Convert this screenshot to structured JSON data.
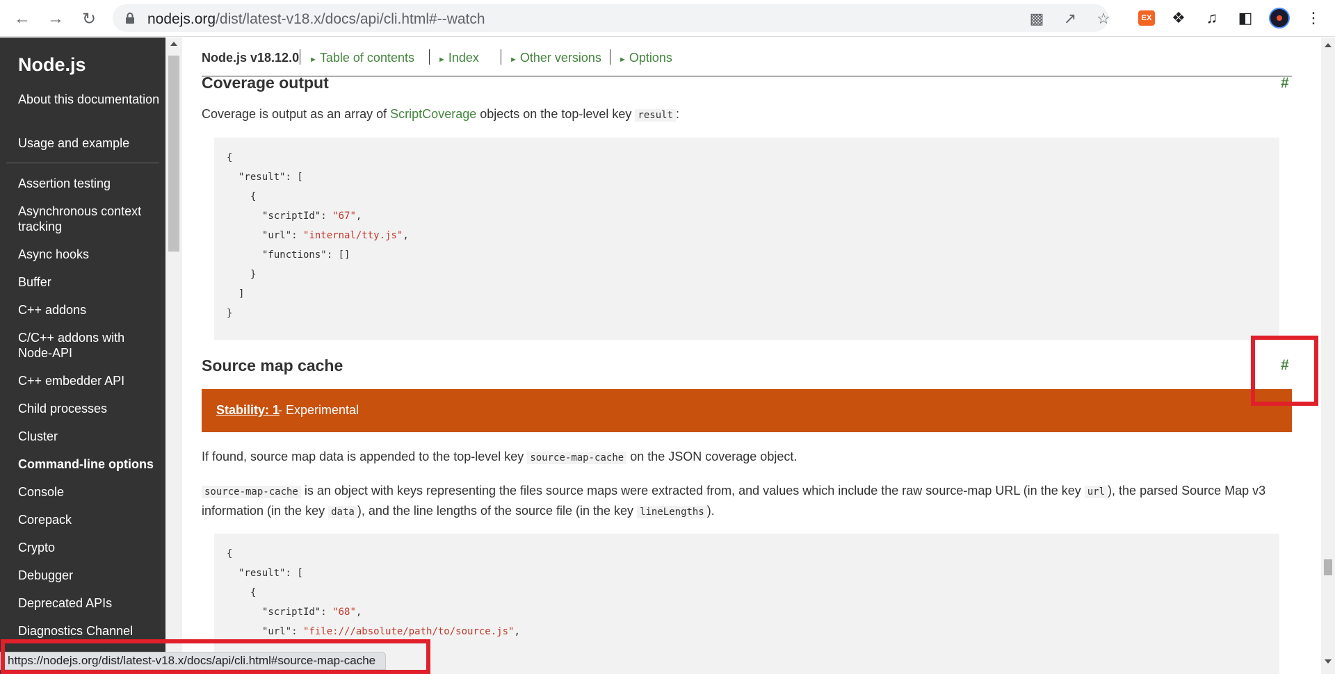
{
  "browser": {
    "url_host": "nodejs.org",
    "url_path": "/dist/latest-v18.x/docs/api/cli.html#--watch",
    "extension_label": "EX"
  },
  "sidebar": {
    "title": "Node.js",
    "top_items": [
      "About this documentation",
      "Usage and example"
    ],
    "items": [
      "Assertion testing",
      "Asynchronous context tracking",
      "Async hooks",
      "Buffer",
      "C++ addons",
      "C/C++ addons with Node-API",
      "C++ embedder API",
      "Child processes",
      "Cluster",
      "Command-line options",
      "Console",
      "Corepack",
      "Crypto",
      "Debugger",
      "Deprecated APIs",
      "Diagnostics Channel"
    ],
    "active_item": "Command-line options"
  },
  "header": {
    "version": "Node.js v18.12.0",
    "links": [
      "Table of contents",
      "Index",
      "Other versions",
      "Options"
    ]
  },
  "content": {
    "coverage_title": "Coverage output",
    "coverage_anchor": "#",
    "coverage_text_1": "Coverage is output as an array of",
    "coverage_link": "ScriptCoverage",
    "coverage_text_2": "objects on the top-level key",
    "coverage_key": "result",
    "coverage_text_3": ":",
    "code1": {
      "l1": "{",
      "l2_key": "\"result\"",
      "l2_rest": ": [",
      "l3": "{",
      "l4_key": "\"scriptId\"",
      "l4_val": "\"67\"",
      "l5_key": "\"url\"",
      "l5_val": "\"internal/tty.js\"",
      "l6_key": "\"functions\"",
      "l6_rest": ": []",
      "l7": "}",
      "l8": "]",
      "l9": "}"
    },
    "smc_title": "Source map cache",
    "smc_anchor": "#",
    "stability_label": "Stability: 1",
    "stability_text": "- Experimental",
    "smc_p1_a": "If found, source map data is appended to the top-level key",
    "smc_p1_code": "source-map-cache",
    "smc_p1_b": "on the JSON coverage object.",
    "smc_p2_code1": "source-map-cache",
    "smc_p2_a": "is an object with keys representing the files source maps were extracted from, and values which include the raw source-map URL (in the key",
    "smc_p2_code2": "url",
    "smc_p2_b": "), the parsed Source Map v3 information (in the key",
    "smc_p2_code3": "data",
    "smc_p2_c": "), and the line lengths of the source file (in the key",
    "smc_p2_code4": "lineLengths",
    "smc_p2_d": ").",
    "code2": {
      "l1": "{",
      "l2_key": "\"result\"",
      "l2_rest": ": [",
      "l3": "{",
      "l4_key": "\"scriptId\"",
      "l4_val": "\"68\"",
      "l5_key": "\"url\"",
      "l5_val": "\"file:///absolute/path/to/source.js\""
    }
  },
  "status_url": "https://nodejs.org/dist/latest-v18.x/docs/api/cli.html#source-map-cache",
  "colors": {
    "sidebar_bg": "#333333",
    "link_green": "#43853d",
    "stability_orange": "#c8510e",
    "highlight_red": "#e0202a"
  }
}
